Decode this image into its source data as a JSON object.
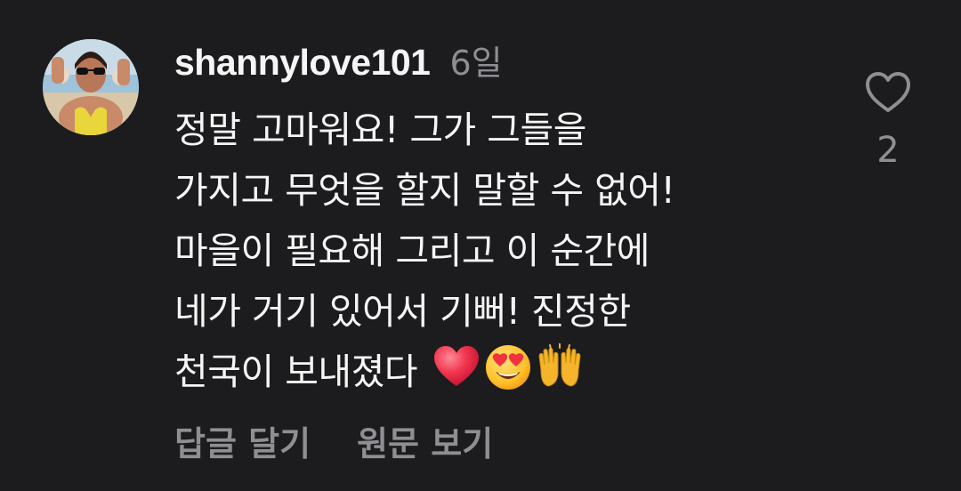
{
  "comment": {
    "username": "shannylove101",
    "timestamp": "6일",
    "text_lines": [
      "정말 고마워요! 그가 그들을",
      "가지고 무엇을 할지 말할 수 없어!",
      "마을이 필요해 그리고 이 순간에",
      "네가 거기 있어서 기뻐! 진정한",
      "천국이 보내졌다 "
    ],
    "emojis": [
      "red-heart",
      "heart-eyes-face",
      "raising-hands"
    ],
    "like_count": "2",
    "actions": {
      "reply_label": "답글 달기",
      "see_original_label": "원문 보기"
    }
  },
  "colors": {
    "background": "#1c1c1e",
    "primary_text": "#f5f5f5",
    "secondary_text": "#8e8e93"
  }
}
